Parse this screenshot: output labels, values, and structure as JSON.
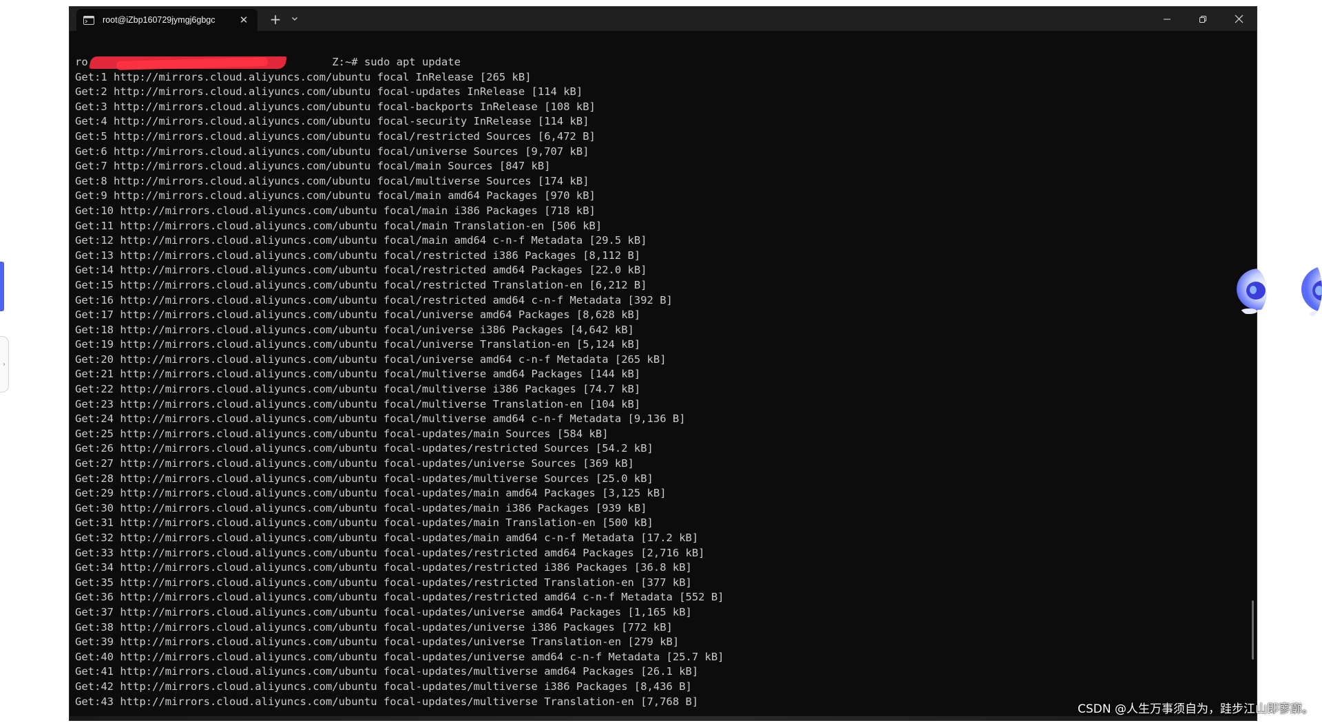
{
  "window": {
    "tab_title": "root@iZbp160729jymgj6gbgc",
    "close_tab": "✕",
    "new_tab": "+",
    "tab_menu": "⌄",
    "minimize": "minimize",
    "maximize": "restore",
    "close_window": "close"
  },
  "terminal": {
    "prompt_start": "ro",
    "prompt_end": "Z:~# ",
    "command": "sudo apt update",
    "lines": [
      "Get:1 http://mirrors.cloud.aliyuncs.com/ubuntu focal InRelease [265 kB]",
      "Get:2 http://mirrors.cloud.aliyuncs.com/ubuntu focal-updates InRelease [114 kB]",
      "Get:3 http://mirrors.cloud.aliyuncs.com/ubuntu focal-backports InRelease [108 kB]",
      "Get:4 http://mirrors.cloud.aliyuncs.com/ubuntu focal-security InRelease [114 kB]",
      "Get:5 http://mirrors.cloud.aliyuncs.com/ubuntu focal/restricted Sources [6,472 B]",
      "Get:6 http://mirrors.cloud.aliyuncs.com/ubuntu focal/universe Sources [9,707 kB]",
      "Get:7 http://mirrors.cloud.aliyuncs.com/ubuntu focal/main Sources [847 kB]",
      "Get:8 http://mirrors.cloud.aliyuncs.com/ubuntu focal/multiverse Sources [174 kB]",
      "Get:9 http://mirrors.cloud.aliyuncs.com/ubuntu focal/main amd64 Packages [970 kB]",
      "Get:10 http://mirrors.cloud.aliyuncs.com/ubuntu focal/main i386 Packages [718 kB]",
      "Get:11 http://mirrors.cloud.aliyuncs.com/ubuntu focal/main Translation-en [506 kB]",
      "Get:12 http://mirrors.cloud.aliyuncs.com/ubuntu focal/main amd64 c-n-f Metadata [29.5 kB]",
      "Get:13 http://mirrors.cloud.aliyuncs.com/ubuntu focal/restricted i386 Packages [8,112 B]",
      "Get:14 http://mirrors.cloud.aliyuncs.com/ubuntu focal/restricted amd64 Packages [22.0 kB]",
      "Get:15 http://mirrors.cloud.aliyuncs.com/ubuntu focal/restricted Translation-en [6,212 B]",
      "Get:16 http://mirrors.cloud.aliyuncs.com/ubuntu focal/restricted amd64 c-n-f Metadata [392 B]",
      "Get:17 http://mirrors.cloud.aliyuncs.com/ubuntu focal/universe amd64 Packages [8,628 kB]",
      "Get:18 http://mirrors.cloud.aliyuncs.com/ubuntu focal/universe i386 Packages [4,642 kB]",
      "Get:19 http://mirrors.cloud.aliyuncs.com/ubuntu focal/universe Translation-en [5,124 kB]",
      "Get:20 http://mirrors.cloud.aliyuncs.com/ubuntu focal/universe amd64 c-n-f Metadata [265 kB]",
      "Get:21 http://mirrors.cloud.aliyuncs.com/ubuntu focal/multiverse amd64 Packages [144 kB]",
      "Get:22 http://mirrors.cloud.aliyuncs.com/ubuntu focal/multiverse i386 Packages [74.7 kB]",
      "Get:23 http://mirrors.cloud.aliyuncs.com/ubuntu focal/multiverse Translation-en [104 kB]",
      "Get:24 http://mirrors.cloud.aliyuncs.com/ubuntu focal/multiverse amd64 c-n-f Metadata [9,136 B]",
      "Get:25 http://mirrors.cloud.aliyuncs.com/ubuntu focal-updates/main Sources [584 kB]",
      "Get:26 http://mirrors.cloud.aliyuncs.com/ubuntu focal-updates/restricted Sources [54.2 kB]",
      "Get:27 http://mirrors.cloud.aliyuncs.com/ubuntu focal-updates/universe Sources [369 kB]",
      "Get:28 http://mirrors.cloud.aliyuncs.com/ubuntu focal-updates/multiverse Sources [25.0 kB]",
      "Get:29 http://mirrors.cloud.aliyuncs.com/ubuntu focal-updates/main amd64 Packages [3,125 kB]",
      "Get:30 http://mirrors.cloud.aliyuncs.com/ubuntu focal-updates/main i386 Packages [939 kB]",
      "Get:31 http://mirrors.cloud.aliyuncs.com/ubuntu focal-updates/main Translation-en [500 kB]",
      "Get:32 http://mirrors.cloud.aliyuncs.com/ubuntu focal-updates/main amd64 c-n-f Metadata [17.2 kB]",
      "Get:33 http://mirrors.cloud.aliyuncs.com/ubuntu focal-updates/restricted amd64 Packages [2,716 kB]",
      "Get:34 http://mirrors.cloud.aliyuncs.com/ubuntu focal-updates/restricted i386 Packages [36.8 kB]",
      "Get:35 http://mirrors.cloud.aliyuncs.com/ubuntu focal-updates/restricted Translation-en [377 kB]",
      "Get:36 http://mirrors.cloud.aliyuncs.com/ubuntu focal-updates/restricted amd64 c-n-f Metadata [552 B]",
      "Get:37 http://mirrors.cloud.aliyuncs.com/ubuntu focal-updates/universe amd64 Packages [1,165 kB]",
      "Get:38 http://mirrors.cloud.aliyuncs.com/ubuntu focal-updates/universe i386 Packages [772 kB]",
      "Get:39 http://mirrors.cloud.aliyuncs.com/ubuntu focal-updates/universe Translation-en [279 kB]",
      "Get:40 http://mirrors.cloud.aliyuncs.com/ubuntu focal-updates/universe amd64 c-n-f Metadata [25.7 kB]",
      "Get:41 http://mirrors.cloud.aliyuncs.com/ubuntu focal-updates/multiverse amd64 Packages [26.1 kB]",
      "Get:42 http://mirrors.cloud.aliyuncs.com/ubuntu focal-updates/multiverse i386 Packages [8,436 B]",
      "Get:43 http://mirrors.cloud.aliyuncs.com/ubuntu focal-updates/multiverse Translation-en [7,768 B]"
    ]
  },
  "watermark": "CSDN @人生万事须自为，跬步江山即寥廓。",
  "colors": {
    "terminal_bg": "#0c0c0c",
    "titlebar_bg": "#202020",
    "text": "#cccccc",
    "redaction": "#e0283a",
    "accent": "#4f63f0"
  },
  "icons": {
    "tab": "terminal-icon",
    "minimize": "minimize-icon",
    "maximize": "restore-icon",
    "close": "close-icon",
    "assistant": "assistant-avatar-icon"
  }
}
